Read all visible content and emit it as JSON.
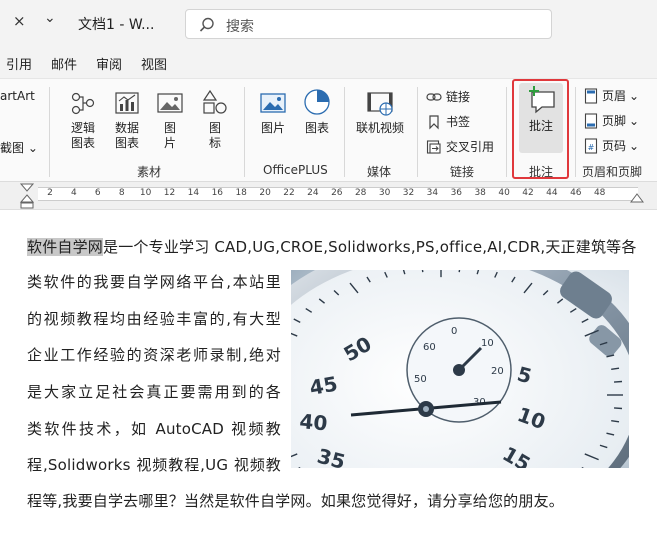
{
  "titlebar": {
    "close_glyph": "×",
    "chevron_glyph": "⌄",
    "title": "文档1  -  W...",
    "search_placeholder": "搜索"
  },
  "menu": [
    "引用",
    "邮件",
    "审阅",
    "视图"
  ],
  "ribbon": {
    "left_partial": {
      "smartart": "artArt",
      "screenshot": "截图",
      "screenshot_arrow": "⌄"
    },
    "sucai_group": {
      "label": "素材",
      "buttons": [
        {
          "label": "逻辑\n图表",
          "icon": "logic-chart-icon"
        },
        {
          "label": "数据\n图表",
          "icon": "data-chart-icon"
        },
        {
          "label": "图\n片",
          "icon": "image-icon"
        },
        {
          "label": "图\n标",
          "icon": "shapes-icon"
        }
      ]
    },
    "officeplus_group": {
      "label": "OfficePLUS",
      "buttons": [
        {
          "label": "图片",
          "icon": "picture-icon"
        },
        {
          "label": "图表",
          "icon": "pie-chart-icon"
        }
      ]
    },
    "media_group": {
      "label": "媒体",
      "buttons": [
        {
          "label": "联机视频",
          "icon": "online-video-icon"
        }
      ]
    },
    "link_group": {
      "label": "链接",
      "items": [
        {
          "label": "链接",
          "icon": "link-icon"
        },
        {
          "label": "书签",
          "icon": "bookmark-icon"
        },
        {
          "label": "交叉引用",
          "icon": "cross-reference-icon"
        }
      ]
    },
    "comment_group": {
      "label": "批注",
      "buttons": [
        {
          "label": "批注",
          "icon": "new-comment-icon"
        }
      ]
    },
    "header_footer_group": {
      "label": "页眉和页脚",
      "items": [
        {
          "label": "页眉",
          "arrow": "⌄",
          "icon": "header-icon"
        },
        {
          "label": "页脚",
          "arrow": "⌄",
          "icon": "footer-icon"
        },
        {
          "label": "页码",
          "arrow": "⌄",
          "icon": "page-number-icon"
        }
      ]
    }
  },
  "ruler": {
    "ticks": [
      "2",
      "4",
      "6",
      "8",
      "10",
      "12",
      "14",
      "16",
      "18",
      "20",
      "22",
      "24",
      "26",
      "28",
      "30",
      "32",
      "34",
      "36",
      "38",
      "40",
      "42",
      "44",
      "46",
      "48"
    ]
  },
  "document": {
    "selected_text": "软件自学网",
    "lines": [
      "是一个专业学习 CAD,UG,CROE,Solidworks,PS,office,AI,CDR,天正建筑等各",
      "类软件的我要自学网络平台,本站里",
      "的视频教程均由经验丰富的,有大型",
      "企业工作经验的资深老师录制,绝对",
      "是大家立足社会真正要需用到的各",
      "类软件技术，如 AutoCAD 视频教",
      "程,Solidworks 视频教程,UG 视频教",
      "程等,我要自学去哪里？当然是软件自学网。如果您觉得好，请分享给您的朋友。"
    ],
    "image_alt": "stopwatch-photo"
  }
}
